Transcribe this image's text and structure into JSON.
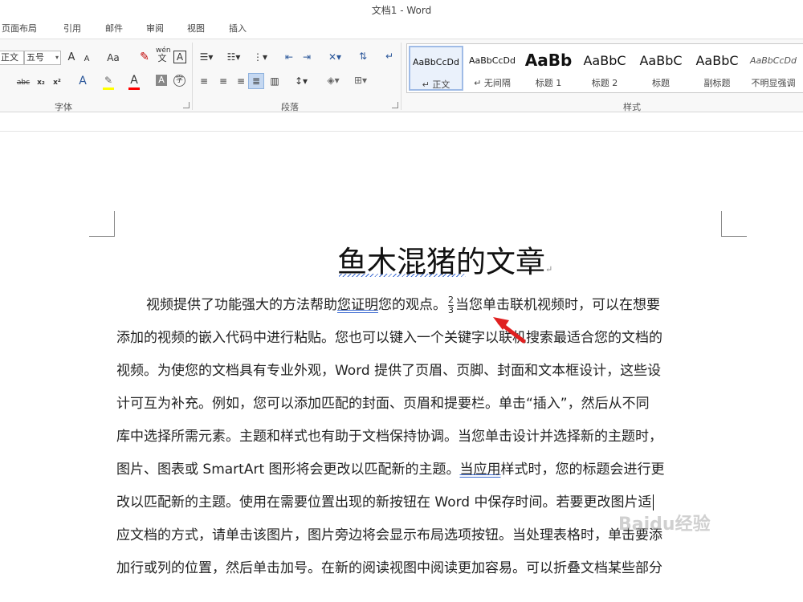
{
  "window": {
    "title": "文档1 - Word"
  },
  "tabs": [
    "页面布局",
    "引用",
    "邮件",
    "审阅",
    "视图",
    "插入"
  ],
  "font_group": {
    "font_name": "正文",
    "font_size": "五号",
    "label": "字体",
    "icons": [
      "grow-font-icon",
      "shrink-font-icon",
      "change-case-icon",
      "clear-formatting-icon",
      "phonetic-guide-icon",
      "character-border-icon",
      "strikethrough-icon",
      "subscript-icon",
      "superscript-icon",
      "text-effects-icon",
      "highlight-icon",
      "font-color-icon",
      "character-shading-icon",
      "enclose-characters-icon"
    ],
    "labels": {
      "grow": "A",
      "shrink": "A",
      "case": "Aa",
      "phonetic_top": "wén",
      "phonetic_bottom": "文",
      "border": "A",
      "strike": "abc",
      "sub": "x₂",
      "sup": "x²",
      "effects": "A",
      "color": "A",
      "shading": "A",
      "enclose": "字"
    },
    "colors": {
      "highlight": "#ffff00",
      "font_color": "#ff0000"
    }
  },
  "paragraph_group": {
    "label": "段落",
    "icons": [
      "bullets-icon",
      "numbering-icon",
      "multilevel-list-icon",
      "decrease-indent-icon",
      "increase-indent-icon",
      "chinese-layout-icon",
      "sort-icon",
      "show-marks-icon",
      "align-left-icon",
      "center-icon",
      "align-right-icon",
      "justify-icon",
      "distributed-icon",
      "line-spacing-icon",
      "shading-icon",
      "borders-icon"
    ]
  },
  "styles_group": {
    "label": "样式",
    "items": [
      {
        "sample": "AaBbCcDd",
        "name": "↵ 正文",
        "selected": true
      },
      {
        "sample": "AaBbCcDd",
        "name": "↵ 无间隔",
        "selected": false
      },
      {
        "sample": "AaBb",
        "name": "标题 1",
        "selected": false
      },
      {
        "sample": "AaBbC",
        "name": "标题 2",
        "selected": false
      },
      {
        "sample": "AaBbC",
        "name": "标题",
        "selected": false
      },
      {
        "sample": "AaBbC",
        "name": "副标题",
        "selected": false
      },
      {
        "sample": "AaBbCcDd",
        "name": "不明显强调",
        "selected": false
      }
    ]
  },
  "document": {
    "title": "鱼木混猪的文章",
    "fraction": {
      "numerator": "2",
      "denominator": "3"
    },
    "lines": [
      {
        "pre": "视频提供了功能强大的方法帮助",
        "under": "您证明",
        "post": "您的观点。",
        "after_frac": "当您单击联机视频时，可以在想要"
      },
      "添加的视频的嵌入代码中进行粘贴。您也可以键入一个关键字以联机搜索最适合您的文档的",
      "视频。为使您的文档具有专业外观，Word 提供了页眉、页脚、封面和文本框设计，这些设",
      "计可互为补充。例如，您可以添加匹配的封面、页眉和提要栏。单击“插入”，然后从不同",
      "库中选择所需元素。主题和样式也有助于文档保持协调。当您单击设计并选择新的主题时，",
      {
        "pre": "图片、图表或 SmartArt 图形将会更改以匹配新的主题。",
        "under": "当应用",
        "post": "样式时，您的标题会进行更"
      },
      "改以匹配新的主题。使用在需要位置出现的新按钮在 Word 中保存时间。若要更改图片适",
      "应文档的方式，请单击该图片，图片旁边将会显示布局选项按钮。当处理表格时，单击要添",
      "加行或列的位置，然后单击加号。在新的阅读视图中阅读更加容易。可以折叠文档某些部分"
    ]
  },
  "annotation": {
    "arrow_color": "#e02020"
  },
  "watermark": "Baidu经验"
}
